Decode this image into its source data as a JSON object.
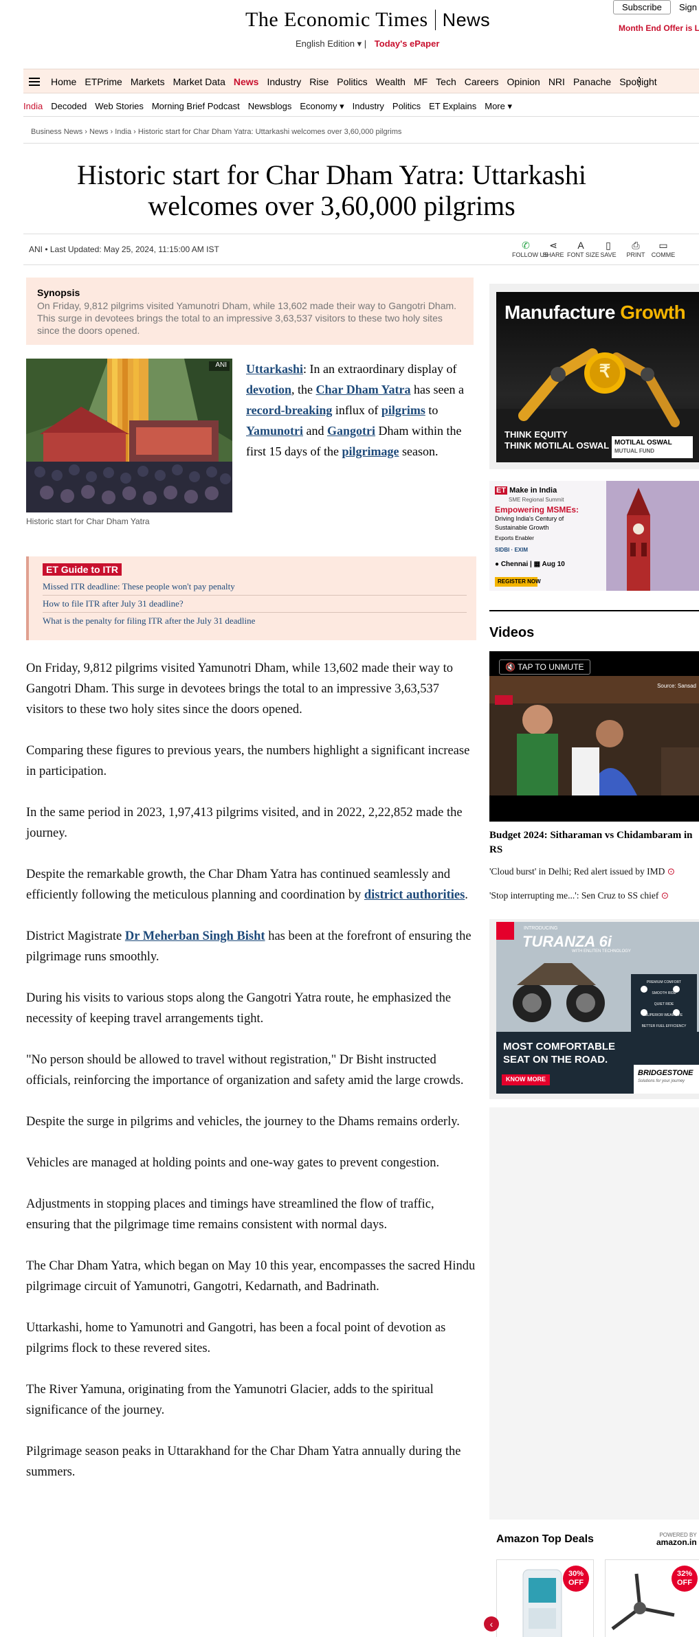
{
  "header": {
    "logo_main": "The Economic Times",
    "logo_sub": "News",
    "edition": "English Edition ▾",
    "edition_sep": "|",
    "epaper": "Today's ePaper",
    "subscribe": "Subscribe",
    "signin": "Sign",
    "offer": "Month End Offer is Li"
  },
  "nav": {
    "primary": [
      "Home",
      "ETPrime",
      "Markets",
      "Market Data",
      "News",
      "Industry",
      "Rise",
      "Politics",
      "Wealth",
      "MF",
      "Tech",
      "Careers",
      "Opinion",
      "NRI",
      "Panache",
      "Spotlight"
    ],
    "active_primary": "News",
    "secondary": [
      "India",
      "Decoded",
      "Web Stories",
      "Morning Brief Podcast",
      "Newsblogs",
      "Economy ▾",
      "Industry",
      "Politics",
      "ET Explains",
      "More ▾"
    ],
    "active_secondary": "India"
  },
  "breadcrumb": "Business News › News › India › Historic start for Char Dham Yatra: Uttarkashi welcomes over 3,60,000 pilgrims",
  "article": {
    "headline": "Historic start for Char Dham Yatra: Uttarkashi welcomes over 3,60,000 pilgrims",
    "byline": "ANI • Last Updated: May 25, 2024, 11:15:00 AM IST",
    "tools": [
      {
        "icon": "whatsapp-icon",
        "label": "FOLLOW US"
      },
      {
        "icon": "share-icon",
        "label": "SHARE"
      },
      {
        "icon": "font-size-icon",
        "label": "FONT SIZE"
      },
      {
        "icon": "bookmark-icon",
        "label": "SAVE"
      },
      {
        "icon": "print-icon",
        "label": "PRINT"
      },
      {
        "icon": "comment-icon",
        "label": "COMME"
      }
    ],
    "synopsis_heading": "Synopsis",
    "synopsis": "On Friday, 9,812 pilgrims visited Yamunotri Dham, while 13,602 made their way to Gangotri Dham. This surge in devotees brings the total to an impressive 3,63,537 visitors to these two holy sites since the doors opened.",
    "image_credit": "ANI",
    "image_caption": "Historic start for Char Dham Yatra",
    "lead": {
      "k1": "Uttarkashi",
      "t1": ": In an extraordinary display of ",
      "k2": "devotion",
      "t2": ", the ",
      "k3": "Char Dham Yatra",
      "t3": " has seen a ",
      "k4": "record-breaking",
      "t4": " influx of ",
      "k5": "pilgrims",
      "t5": " to ",
      "k6": "Yamunotri",
      "t6": " and ",
      "k7": "Gangotri",
      "t7": " Dham within the first 15 days of the ",
      "k8": "pilgrimage",
      "t8": " season."
    },
    "guide": {
      "tag": "ET Guide to ITR",
      "links": [
        "Missed ITR deadline: These people won't pay penalty",
        "How to file ITR after July 31 deadline?",
        "What is the penalty for filing ITR after the July 31 deadline"
      ]
    },
    "paragraphs": {
      "p1": "On Friday, 9,812 pilgrims visited Yamunotri Dham, while 13,602 made their way to Gangotri Dham. This surge in devotees brings the total to an impressive 3,63,537 visitors to these two holy sites since the doors opened.",
      "p2": "Comparing these figures to previous years, the numbers highlight a significant increase in participation.",
      "p3": "In the same period in 2023, 1,97,413 pilgrims visited, and in 2022, 2,22,852 made the journey.",
      "p4a": "Despite the remarkable growth, the Char Dham Yatra has continued seamlessly and efficiently following the meticulous planning and coordination by ",
      "p4k": "district authorities",
      "p4b": ".",
      "p5a": "District Magistrate ",
      "p5k": "Dr Meherban Singh Bisht",
      "p5b": " has been at the forefront of ensuring the pilgrimage runs smoothly.",
      "p6": "During his visits to various stops along the Gangotri Yatra route, he emphasized the necessity of keeping travel arrangements tight.",
      "p7": "\"No person should be allowed to travel without registration,\" Dr Bisht instructed officials, reinforcing the importance of organization and safety amid the large crowds.",
      "p8": "Despite the surge in pilgrims and vehicles, the journey to the Dhams remains orderly.",
      "p9": "Vehicles are managed at holding points and one-way gates to prevent congestion.",
      "p10": "Adjustments in stopping places and timings have streamlined the flow of traffic, ensuring that the pilgrimage time remains consistent with normal days.",
      "p11": "The Char Dham Yatra, which began on May 10 this year, encompasses the sacred Hindu pilgrimage circuit of Yamunotri, Gangotri, Kedarnath, and Badrinath.",
      "p12": "Uttarkashi, home to Yamunotri and Gangotri, has been a focal point of devotion as pilgrims flock to these revered sites.",
      "p13": "The River Yamuna, originating from the Yamunotri Glacier, adds to the spiritual significance of the journey.",
      "p14": "Pilgrimage season peaks in Uttarakhand for the Char Dham Yatra annually during the summers."
    }
  },
  "sidebar": {
    "ad1": {
      "line1": "Manufacture",
      "line2": "Growth",
      "tag1": "THINK EQUITY",
      "tag2": "THINK MOTILAL OSWAL",
      "brand": "MOTILAL OSWAL",
      "brand_sub": "MUTUAL FUND",
      "symbol": "₹"
    },
    "ad2": {
      "brand": "ET",
      "event": "Make in India",
      "event_sub": "SME Regional Summit",
      "headline": "Empowering MSMEs:",
      "sub": "Driving India's Century of Sustainable Growth",
      "enabler": "Exports Enabler",
      "sponsor": "SIDBI · EXIM",
      "city": "Chennai",
      "date": "Aug 10",
      "cta": "REGISTER NOW"
    },
    "videos_heading": "Videos",
    "video": {
      "unmute": "TAP TO UNMUTE",
      "source": "Source: Sansad",
      "title": "Budget 2024: Sitharaman vs Chidambaram in RS"
    },
    "video_links": [
      "'Cloud burst' in Delhi; Red alert issued by IMD",
      "'Stop interrupting me...': Sen Cruz to SS chief"
    ],
    "ad3": {
      "intro": "INTRODUCING",
      "product": "TURANZA 6i",
      "tech": "WITH ENLITEN TECHNOLOGY",
      "headline1": "MOST COMFORTABLE",
      "headline2": "SEAT ON THE ROAD.",
      "cta": "KNOW MORE",
      "brand": "BRIDGESTONE",
      "brand_sub": "Solutions for your journey",
      "features": [
        "PREMIUM COMFORT",
        "SMOOTH RIDE",
        "QUIET RIDE",
        "SUPERIOR WEAR LIFE",
        "BETTER FUEL EFFICIENCY"
      ]
    },
    "amazon": {
      "heading": "Amazon Top Deals",
      "powered": "POWERED BY",
      "powered_brand": "amazon.in",
      "deals": [
        {
          "off": "30%",
          "label": "OFF"
        },
        {
          "off": "32%",
          "label": "OFF"
        }
      ]
    }
  },
  "colors": {
    "brand_red": "#c8102e",
    "nav_bg": "#fdeee6",
    "link_blue": "#1e4a7a"
  }
}
